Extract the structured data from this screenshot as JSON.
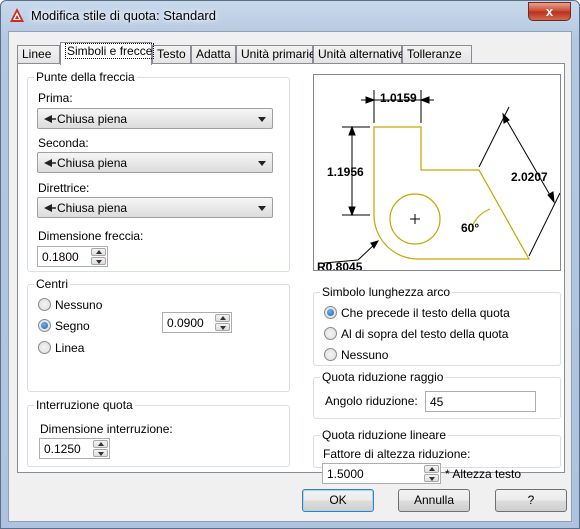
{
  "window": {
    "title": "Modifica stile di quota: Standard",
    "close_glyph": "x"
  },
  "tabs": [
    {
      "label": "Linee"
    },
    {
      "label": "Simboli e frecce"
    },
    {
      "label": "Testo"
    },
    {
      "label": "Adatta"
    },
    {
      "label": "Unità primarie"
    },
    {
      "label": "Unità alternative"
    },
    {
      "label": "Tolleranze"
    }
  ],
  "arrowheads": {
    "legend": "Punte della freccia",
    "first_label": "Prima:",
    "first_value": "Chiusa piena",
    "second_label": "Seconda:",
    "second_value": "Chiusa piena",
    "leader_label": "Direttrice:",
    "leader_value": "Chiusa piena",
    "size_label": "Dimensione freccia:",
    "size_value": "0.1800"
  },
  "centers": {
    "legend": "Centri",
    "options": [
      "Nessuno",
      "Segno",
      "Linea"
    ],
    "selected": "Segno",
    "size_value": "0.0900"
  },
  "break": {
    "legend": "Interruzione quota",
    "size_label": "Dimensione interruzione:",
    "size_value": "0.1250"
  },
  "preview": {
    "dim_top": "1.0159",
    "dim_left": "1.1956",
    "dim_right": "2.0207",
    "angle": "60°",
    "radius": "R0.8045"
  },
  "arc_symbol": {
    "legend": "Simbolo lunghezza arco",
    "options": [
      "Che precede il testo della quota",
      "Al di sopra del testo della quota",
      "Nessuno"
    ],
    "selected": "Che precede il testo della quota"
  },
  "radius_jog": {
    "legend": "Quota riduzione raggio",
    "label": "Angolo riduzione:",
    "value": "45"
  },
  "linear_jog": {
    "legend": "Quota riduzione lineare",
    "label": "Fattore di altezza riduzione:",
    "value": "1.5000",
    "suffix": "* Altezza testo"
  },
  "buttons": {
    "ok": "OK",
    "cancel": "Annulla",
    "help": "?"
  },
  "colors": {
    "preview_geometry": "#c9a400",
    "preview_dims": "#000000"
  }
}
